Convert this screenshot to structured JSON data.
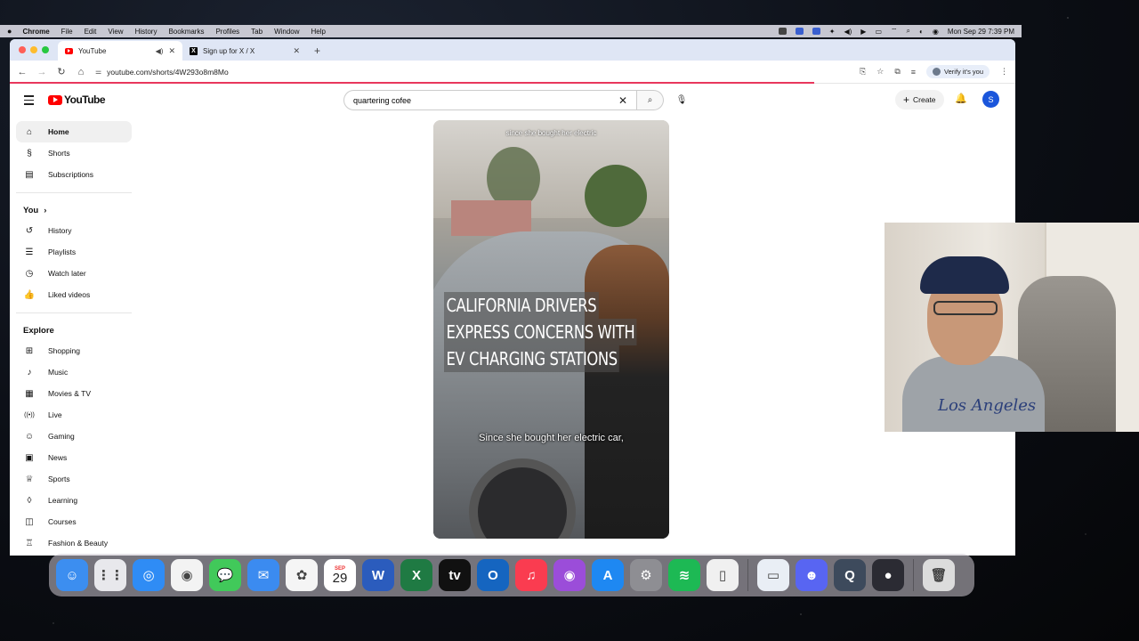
{
  "menubar": {
    "apple": "",
    "app": "Chrome",
    "items": [
      "File",
      "Edit",
      "View",
      "History",
      "Bookmarks",
      "Profiles",
      "Tab",
      "Window",
      "Help"
    ],
    "clock": "Mon Sep 29  7:39 PM"
  },
  "browser": {
    "tabs": [
      {
        "title": "YouTube",
        "active": true
      },
      {
        "title": "Sign up for X / X",
        "active": false
      }
    ],
    "url": "youtube.com/shorts/4W293o8m8Mo",
    "verify_label": "Verify it's you"
  },
  "youtube": {
    "logo_text": "YouTube",
    "search_value": "quartering cofee",
    "create_label": "Create",
    "avatar_letter": "S",
    "sidebar": {
      "main": [
        {
          "label": "Home",
          "icon": "home-icon",
          "glyph": "⌂"
        },
        {
          "label": "Shorts",
          "icon": "shorts-icon",
          "glyph": "§"
        },
        {
          "label": "Subscriptions",
          "icon": "subscriptions-icon",
          "glyph": "▤"
        }
      ],
      "you_header": "You",
      "you": [
        {
          "label": "History",
          "icon": "history-icon",
          "glyph": "↺"
        },
        {
          "label": "Playlists",
          "icon": "playlists-icon",
          "glyph": "☰"
        },
        {
          "label": "Watch later",
          "icon": "clock-icon",
          "glyph": "◷"
        },
        {
          "label": "Liked videos",
          "icon": "thumbs-up-icon",
          "glyph": "👍"
        }
      ],
      "explore_header": "Explore",
      "explore": [
        {
          "label": "Shopping",
          "icon": "shopping-icon",
          "glyph": "⊞"
        },
        {
          "label": "Music",
          "icon": "music-icon",
          "glyph": "♪"
        },
        {
          "label": "Movies & TV",
          "icon": "film-icon",
          "glyph": "▦"
        },
        {
          "label": "Live",
          "icon": "live-icon",
          "glyph": "((•))"
        },
        {
          "label": "Gaming",
          "icon": "gaming-icon",
          "glyph": "☺"
        },
        {
          "label": "News",
          "icon": "news-icon",
          "glyph": "▣"
        },
        {
          "label": "Sports",
          "icon": "trophy-icon",
          "glyph": "♕"
        },
        {
          "label": "Learning",
          "icon": "learning-icon",
          "glyph": "◊"
        },
        {
          "label": "Courses",
          "icon": "courses-icon",
          "glyph": "◫"
        },
        {
          "label": "Fashion & Beauty",
          "icon": "fashion-icon",
          "glyph": "♖"
        }
      ]
    },
    "video": {
      "top_caption": "since she bought her electric",
      "headline_lines": [
        "CALIFORNIA DRIVERS",
        "EXPRESS CONCERNS WITH",
        "EV CHARGING STATIONS"
      ],
      "subtitle": "Since she bought her electric car,"
    }
  },
  "webcam": {
    "shirt_text": "Los Angeles"
  },
  "dock": {
    "apps": [
      {
        "name": "finder",
        "color": "#3c8ef0",
        "glyph": "☺"
      },
      {
        "name": "launchpad",
        "color": "#e8e8ec",
        "glyph": "⋮⋮"
      },
      {
        "name": "safari",
        "color": "#2f8cf5",
        "glyph": "◎"
      },
      {
        "name": "chrome",
        "color": "#f3f3f3",
        "glyph": "◉"
      },
      {
        "name": "messages",
        "color": "#41c95a",
        "glyph": "💬"
      },
      {
        "name": "mail",
        "color": "#3b8bf0",
        "glyph": "✉"
      },
      {
        "name": "photos",
        "color": "#f5f5f5",
        "glyph": "✿"
      },
      {
        "name": "calendar",
        "color": "#ffffff",
        "glyph": "29"
      },
      {
        "name": "word",
        "color": "#2b5cbd",
        "glyph": "W"
      },
      {
        "name": "excel",
        "color": "#1f7a43",
        "glyph": "X"
      },
      {
        "name": "apple-tv",
        "color": "#111111",
        "glyph": "tv"
      },
      {
        "name": "outlook",
        "color": "#1565c0",
        "glyph": "O"
      },
      {
        "name": "music",
        "color": "#fa3c50",
        "glyph": "♫"
      },
      {
        "name": "podcasts",
        "color": "#9b4dd9",
        "glyph": "◉"
      },
      {
        "name": "app-store",
        "color": "#1e88f2",
        "glyph": "A"
      },
      {
        "name": "system-settings",
        "color": "#8e8e93",
        "glyph": "⚙"
      },
      {
        "name": "spotify",
        "color": "#1db954",
        "glyph": "≋"
      },
      {
        "name": "iphone-mirroring",
        "color": "#f0f0f0",
        "glyph": "▯"
      },
      {
        "name": "preview",
        "color": "#e9eef5",
        "glyph": "▭"
      },
      {
        "name": "discord",
        "color": "#5865f2",
        "glyph": "☻"
      },
      {
        "name": "quicktime",
        "color": "#3d4a5c",
        "glyph": "Q"
      },
      {
        "name": "obs",
        "color": "#2b2b33",
        "glyph": "●"
      },
      {
        "name": "trash",
        "color": "#dcdcdc",
        "glyph": "🗑"
      }
    ],
    "calendar_month": "SEP"
  }
}
